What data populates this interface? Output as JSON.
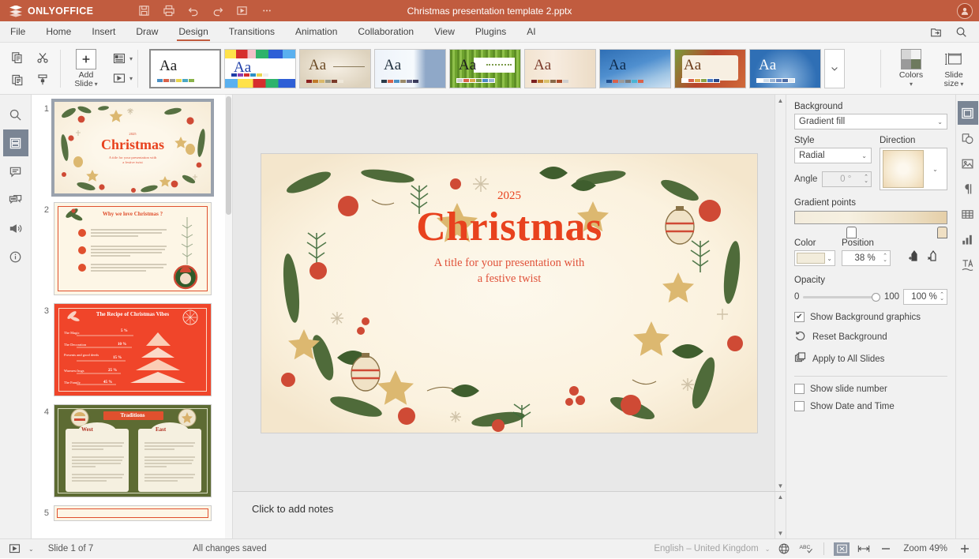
{
  "titlebar": {
    "brand": "ONLYOFFICE",
    "document_title": "Christmas presentation template 2.pptx",
    "quick_access": [
      {
        "name": "save-icon",
        "label": "Save"
      },
      {
        "name": "print-icon",
        "label": "Print"
      },
      {
        "name": "undo-icon",
        "label": "Undo"
      },
      {
        "name": "redo-icon",
        "label": "Redo"
      },
      {
        "name": "start-slideshow-icon",
        "label": "Start slideshow"
      },
      {
        "name": "more-icon",
        "label": "More"
      }
    ],
    "avatar_initial": ""
  },
  "menu": {
    "items": [
      {
        "label": "File",
        "active": false
      },
      {
        "label": "Home",
        "active": false
      },
      {
        "label": "Insert",
        "active": false
      },
      {
        "label": "Draw",
        "active": false
      },
      {
        "label": "Design",
        "active": true
      },
      {
        "label": "Transitions",
        "active": false
      },
      {
        "label": "Animation",
        "active": false
      },
      {
        "label": "Collaboration",
        "active": false
      },
      {
        "label": "View",
        "active": false
      },
      {
        "label": "Plugins",
        "active": false
      },
      {
        "label": "AI",
        "active": false
      }
    ],
    "right_icons": [
      {
        "name": "open-file-location-icon"
      },
      {
        "name": "search-icon"
      }
    ]
  },
  "ribbon": {
    "clipboard": [
      {
        "name": "copy-icon"
      },
      {
        "name": "cut-icon"
      },
      {
        "name": "paste-icon"
      },
      {
        "name": "copy-style-icon"
      }
    ],
    "add_slide": {
      "line1": "Add",
      "line2": "Slide"
    },
    "slide_ops": [
      {
        "name": "slide-layout-icon"
      },
      {
        "name": "slide-transition-icon"
      }
    ],
    "themes": [
      {
        "name": "theme-blank",
        "selected": true,
        "aa_color": "#1c1c1c",
        "bg": "#ffffff",
        "swatches": [
          "#4a90c4",
          "#d9624a",
          "#9b9b9b",
          "#e8d44d",
          "#4aa7c4",
          "#8ab34a"
        ]
      },
      {
        "name": "theme-colorful",
        "selected": false,
        "aa_color": "#1f3fa8",
        "bg": "#ffffff",
        "swatches": [
          "#1f3fa8",
          "#8f3fb0",
          "#d62e2e",
          "#2e8fc4",
          "#e8d44d",
          "#efefef"
        ]
      },
      {
        "name": "theme-parchment",
        "selected": false,
        "aa_color": "#6b4a24",
        "bg": "#e9e0cf",
        "swatches": [
          "#8d2020",
          "#c07a2a",
          "#d9b86a",
          "#9a9a8a",
          "#7a3a2a",
          "#efe8da"
        ]
      },
      {
        "name": "theme-clouds",
        "selected": false,
        "aa_color": "#22313f",
        "bg": "#eef3fa",
        "swatches": [
          "#2b3b4a",
          "#d9624a",
          "#4a90c4",
          "#9a8a6a",
          "#6a6a8a",
          "#3a3a5a"
        ]
      },
      {
        "name": "theme-green",
        "selected": false,
        "aa_color": "#1c1c1c",
        "bg": "#6ea32e",
        "swatches": [
          "#cfcfcf",
          "#d9624a",
          "#d9a94a",
          "#7a9a4a",
          "#4a8ac4",
          "#9ab4d4"
        ]
      },
      {
        "name": "theme-beige",
        "selected": false,
        "aa_color": "#7a3a2a",
        "bg": "#f0e2cf",
        "swatches": [
          "#7a2020",
          "#c07a2a",
          "#d9c06a",
          "#8a6a4a",
          "#aa4a2a",
          "#d0d0d0"
        ]
      },
      {
        "name": "theme-blue-wave",
        "selected": false,
        "aa_color": "#1c1c1c",
        "bg": "#3d7ebf",
        "swatches": [
          "#1f4f8f",
          "#d9624a",
          "#9a9a9a",
          "#7a7a7a",
          "#4ab4d4",
          "#d9624a"
        ]
      },
      {
        "name": "theme-berry",
        "selected": false,
        "aa_color": "#6b3a18",
        "bg": "#a33a28",
        "swatches": [
          "#ffffff",
          "#d9624a",
          "#d9a94a",
          "#8aa34a",
          "#4a7ac4",
          "#2a4a8a"
        ]
      },
      {
        "name": "theme-blue-dots",
        "selected": false,
        "aa_color": "#ffffff",
        "bg": "#2f6fb5",
        "swatches": [
          "#ffffff",
          "#cfdcea",
          "#9ab4d4",
          "#6a8ac4",
          "#4a6aa4",
          "#dfe8f2"
        ]
      }
    ],
    "theme_more": {
      "name": "theme-gallery-expand"
    },
    "colors_button": {
      "label1": "Colors"
    },
    "slide_size_button": {
      "label1": "Slide",
      "label2": "size"
    }
  },
  "left_sidebar": {
    "items": [
      {
        "name": "search-panel-icon",
        "active": false
      },
      {
        "name": "slides-panel-icon",
        "active": true
      },
      {
        "name": "comments-panel-icon",
        "active": false
      },
      {
        "name": "chat-panel-icon",
        "active": false
      },
      {
        "name": "feedback-panel-icon",
        "active": false
      },
      {
        "name": "about-panel-icon",
        "active": false
      }
    ]
  },
  "thumbnails": [
    {
      "number": "1",
      "selected": true,
      "type": "title",
      "year": "2025",
      "title": "Christmas",
      "subtitle_line1": "A title for your presentation with",
      "subtitle_line2": "a festive twist"
    },
    {
      "number": "2",
      "selected": false,
      "type": "bullets",
      "title": "Why we love Christmas ?",
      "bullets": [
        "Christmas is one of the most magical and culturally celebrated winter holidays.",
        "Beyond the festivity, Christmas brings people together with lights and decorations.",
        "One of the best traditions is gift giving and good deeds for loved ones."
      ]
    },
    {
      "number": "3",
      "selected": false,
      "type": "pyramid",
      "title": "The Recipe of Christmas Vibes",
      "rows": [
        {
          "label": "The Magic",
          "value": "5 %"
        },
        {
          "label": "The Decoration",
          "value": "10 %"
        },
        {
          "label": "Presents and good deeds",
          "value": "15 %"
        },
        {
          "label": "Warmest hugs",
          "value": "25 %"
        },
        {
          "label": "The Family",
          "value": "45 %"
        }
      ]
    },
    {
      "number": "4",
      "selected": false,
      "type": "two-column",
      "title": "Traditions",
      "col_left": "West",
      "col_right": "East"
    },
    {
      "number": "5",
      "selected": false,
      "type": "partial",
      "title": ""
    }
  ],
  "canvas": {
    "slide": {
      "year": "2025",
      "title": "Christmas",
      "subtitle_line1": "A title for your presentation with",
      "subtitle_line2": "a festive twist"
    },
    "notes_placeholder": "Click to add notes"
  },
  "right_panel": {
    "section_title": "Background",
    "fill_select": {
      "value": "Gradient fill",
      "name": "background-fill-select"
    },
    "style_label": "Style",
    "style_select": {
      "value": "Radial"
    },
    "direction_label": "Direction",
    "angle_label": "Angle",
    "angle_value": "0 °",
    "gradient_points_label": "Gradient points",
    "color_label": "Color",
    "position_label": "Position",
    "position_value": "38 %",
    "opacity_label": "Opacity",
    "opacity_min": "0",
    "opacity_max": "100",
    "opacity_value": "100 %",
    "show_background_graphics": {
      "label": "Show Background graphics",
      "checked": true
    },
    "reset_background": "Reset Background",
    "apply_to_all_slides": "Apply to All Slides",
    "show_slide_number": {
      "label": "Show slide number",
      "checked": false
    },
    "show_date_time": {
      "label": "Show Date and Time",
      "checked": false
    },
    "gradient_color_hex": "#f2ecdb"
  },
  "right_sidebar": {
    "items": [
      {
        "name": "slide-settings-icon",
        "active": true
      },
      {
        "name": "shape-settings-icon",
        "active": false
      },
      {
        "name": "image-settings-icon",
        "active": false
      },
      {
        "name": "paragraph-settings-icon",
        "active": false
      },
      {
        "name": "table-settings-icon",
        "active": false
      },
      {
        "name": "chart-settings-icon",
        "active": false
      },
      {
        "name": "text-art-settings-icon",
        "active": false
      }
    ]
  },
  "status_bar": {
    "slide_counter": "Slide 1 of 7",
    "save_state": "All changes saved",
    "language": "English – United Kingdom",
    "zoom_label": "Zoom 49%",
    "icons": [
      {
        "name": "start-slideshow-icon"
      },
      {
        "name": "set-language-icon"
      },
      {
        "name": "spell-checking-icon"
      },
      {
        "name": "fit-slide-icon"
      },
      {
        "name": "fit-width-icon"
      },
      {
        "name": "zoom-out-icon"
      },
      {
        "name": "zoom-in-icon"
      }
    ]
  },
  "colors": {
    "brand": "#c15c3f",
    "accent_red": "#e8421e",
    "panel_bg": "#f1f1f1",
    "canvas_bg": "#e8e8e8",
    "slide_bg": "#fcf4e3",
    "active_blue_grey": "#7a8594"
  }
}
